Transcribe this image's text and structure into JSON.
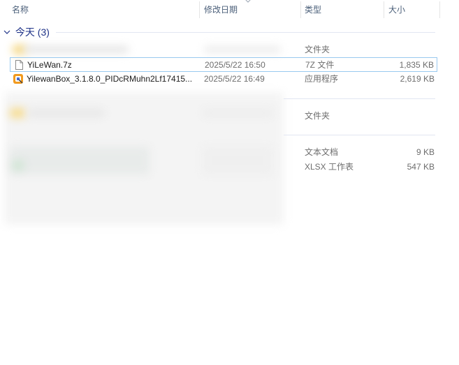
{
  "columns": {
    "name": "名称",
    "date": "修改日期",
    "type": "类型",
    "size": "大小"
  },
  "group": {
    "label": "今天 (3)"
  },
  "rows": [
    {
      "name": "",
      "date": "",
      "type": "文件夹",
      "size": "",
      "icon": "folder-icon",
      "blurred": true
    },
    {
      "name": "YiLeWan.7z",
      "date": "2025/5/22 16:50",
      "type": "7Z 文件",
      "size": "1,835 KB",
      "icon": "archive-file-icon",
      "selected": true
    },
    {
      "name": "YilewanBox_3.1.8.0_PIDcRMuhn2Lf17415...",
      "date": "2025/5/22 16:49",
      "type": "应用程序",
      "size": "2,619 KB",
      "icon": "app-installer-icon"
    }
  ],
  "obscured_rows": [
    {
      "type": "文件夹",
      "size": ""
    },
    {
      "type": "文本文档",
      "size": "9 KB"
    },
    {
      "type": "XLSX 工作表",
      "size": "547 KB"
    }
  ],
  "colors": {
    "header_text": "#4c607a",
    "group_text": "#1e3287",
    "selection_border": "#99c9ef",
    "secondary_text": "#6d6d6d"
  }
}
